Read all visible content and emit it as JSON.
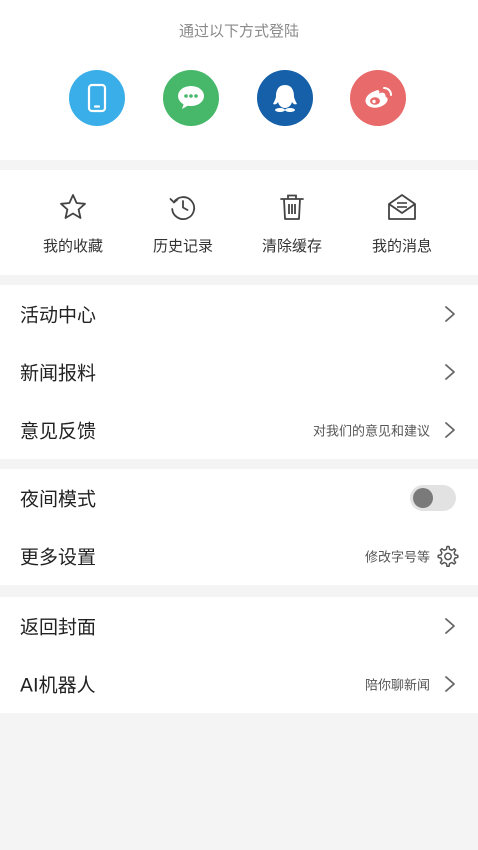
{
  "login": {
    "title": "通过以下方式登陆",
    "methods": [
      {
        "icon": "phone-icon",
        "color": "#3aaee8"
      },
      {
        "icon": "wechat-icon",
        "color": "#47b86a"
      },
      {
        "icon": "qq-icon",
        "color": "#1560a8"
      },
      {
        "icon": "weibo-icon",
        "color": "#e86a6a"
      }
    ]
  },
  "quick_actions": [
    {
      "label": "我的收藏",
      "icon": "star-icon"
    },
    {
      "label": "历史记录",
      "icon": "history-icon"
    },
    {
      "label": "清除缓存",
      "icon": "trash-icon"
    },
    {
      "label": "我的消息",
      "icon": "mail-icon"
    }
  ],
  "menu": {
    "activity": {
      "label": "活动中心"
    },
    "news_report": {
      "label": "新闻报料"
    },
    "feedback": {
      "label": "意见反馈",
      "hint": "对我们的意见和建议"
    },
    "night_mode": {
      "label": "夜间模式",
      "enabled": false
    },
    "more_settings": {
      "label": "更多设置",
      "hint": "修改字号等"
    },
    "back_cover": {
      "label": "返回封面"
    },
    "ai_robot": {
      "label": "AI机器人",
      "hint": "陪你聊新闻"
    }
  },
  "colors": {
    "background": "#f4f4f4",
    "icon_stroke": "#444444",
    "chevron": "#666666"
  }
}
